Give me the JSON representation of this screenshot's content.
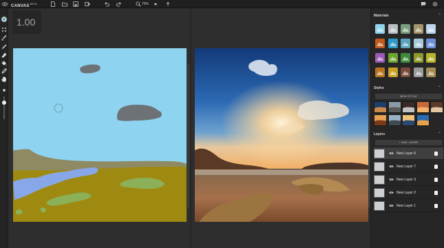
{
  "topbar": {
    "app_name": "CANVAS",
    "badge": "BETA",
    "zoom": "75%",
    "icons": [
      "nvidia-logo-icon",
      "new-file-icon",
      "open-folder-icon",
      "save-icon",
      "export-icon",
      "undo-icon",
      "redo-icon",
      "zoom-icon",
      "dropdown-arrow-icon",
      "chat-icon",
      "settings-gear-icon"
    ]
  },
  "tools": [
    "brush-circle-icon",
    "grid-icon",
    "brush-icon",
    "pencil-icon",
    "eraser-icon",
    "fill-icon",
    "eyedropper-icon",
    "pan-hand-icon",
    "brush-size-slider"
  ],
  "workspace": {
    "zoom_display": "1.00"
  },
  "panel": {
    "materials_title": "Materials",
    "styles_title": "Styles",
    "new_style_label": "NEW STYLE",
    "layers_title": "Layers",
    "add_layer_label": "+ ADD LAYER",
    "materials": [
      {
        "name": "sky-material",
        "color": "#8fd3ec"
      },
      {
        "name": "cloud-material",
        "color": "#b9bfc4"
      },
      {
        "name": "mountain-material",
        "color": "#7a9d7e"
      },
      {
        "name": "hill-material",
        "color": "#a3966a"
      },
      {
        "name": "snow-mountain-material",
        "color": "#bcd5ea"
      },
      {
        "name": "volcano-material",
        "color": "#c05a1c"
      },
      {
        "name": "water-material",
        "color": "#2e9ac7"
      },
      {
        "name": "sea-material",
        "color": "#5aa3bd"
      },
      {
        "name": "fog-material",
        "color": "#a6c7d8"
      },
      {
        "name": "river-material",
        "color": "#6e8fd6"
      },
      {
        "name": "flower-material",
        "color": "#9c5ab5"
      },
      {
        "name": "grass-material",
        "color": "#6ca632"
      },
      {
        "name": "bush-material",
        "color": "#3f8a3a"
      },
      {
        "name": "tree-material",
        "color": "#8b9a2b"
      },
      {
        "name": "field-material",
        "color": "#b8b32a"
      },
      {
        "name": "dirt-material",
        "color": "#b8741d"
      },
      {
        "name": "sand-material",
        "color": "#c7a227"
      },
      {
        "name": "rock-material",
        "color": "#7a4a3a"
      },
      {
        "name": "stone-material",
        "color": "#9a9a9a"
      },
      {
        "name": "wall-material",
        "color": "#a38b54"
      }
    ],
    "styles": [
      "style-1",
      "style-2",
      "style-3",
      "style-4",
      "style-5",
      "style-6",
      "style-7",
      "style-8",
      "style-9"
    ],
    "layers": [
      {
        "name": "New Layer 6",
        "selected": true
      },
      {
        "name": "New Layer 7",
        "selected": false
      },
      {
        "name": "New Layer 3",
        "selected": false
      },
      {
        "name": "New Layer 2",
        "selected": false
      },
      {
        "name": "New Layer 1",
        "selected": false
      }
    ]
  }
}
